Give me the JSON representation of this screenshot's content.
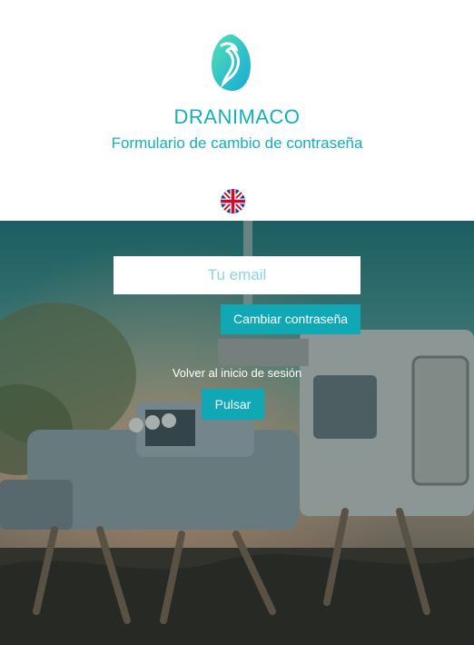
{
  "header": {
    "brand": "DRANIMACO",
    "subtitle": "Formulario de cambio de contraseña",
    "logo_icon": "dragon-logo-icon",
    "language_flag": "uk-flag-icon"
  },
  "form": {
    "email_placeholder": "Tu email",
    "email_value": "",
    "submit_label": "Cambiar contraseña"
  },
  "back": {
    "label": "Volver al inicio de sesión",
    "button_label": "Pulsar"
  },
  "colors": {
    "accent": "#15aebc",
    "button": "#11a8b6"
  }
}
